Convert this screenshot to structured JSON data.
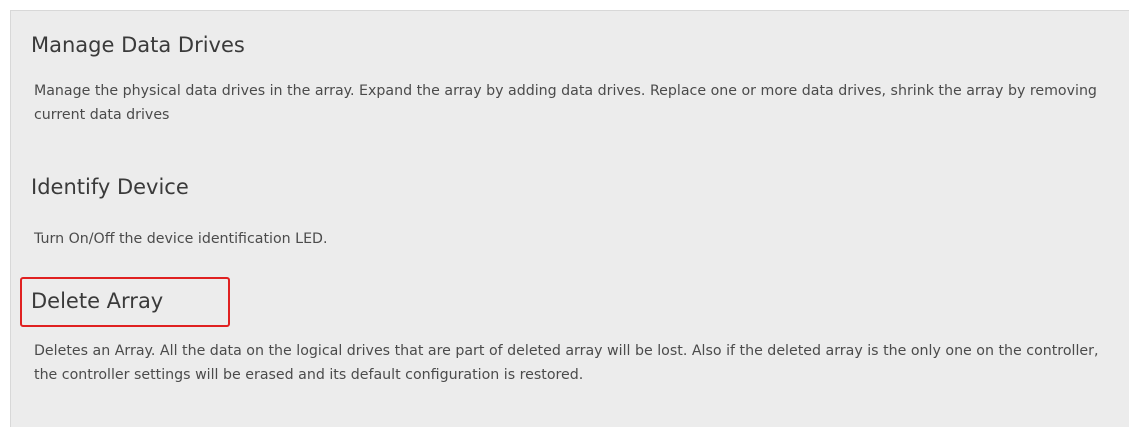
{
  "sections": [
    {
      "title": "Manage Data Drives",
      "description": "Manage the physical data drives in the array. Expand the array by adding data drives. Replace one or more data drives, shrink the array by removing current data drives"
    },
    {
      "title": "Identify Device",
      "description": "Turn On/Off the device identification LED."
    },
    {
      "title": "Delete Array",
      "description": "Deletes an Array. All the data on the logical drives that are part of deleted array will be lost. Also if the deleted array is the only one on the controller, the controller settings will be erased and its default configuration is restored."
    }
  ],
  "highlight_color": "#e02121"
}
